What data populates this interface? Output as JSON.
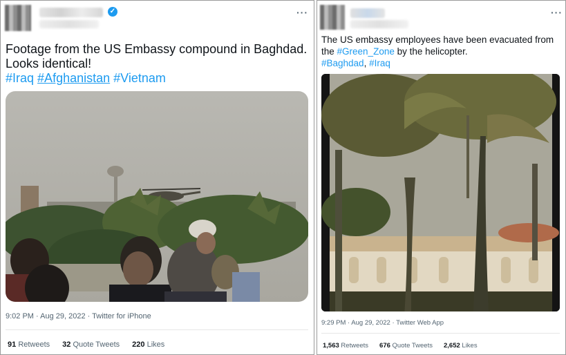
{
  "tweet1": {
    "text_line1": "Footage from the US Embassy compound in Baghdad.",
    "text_line2": "Looks identical!",
    "hashtags": [
      "#Iraq",
      "#Afghanistan",
      "#Vietnam"
    ],
    "timestamp": "9:02 PM · Aug 29, 2022 · Twitter for iPhone",
    "stats": {
      "retweets_count": "91",
      "retweets_label": "Retweets",
      "quotes_count": "32",
      "quotes_label": "Quote Tweets",
      "likes_count": "220",
      "likes_label": "Likes"
    },
    "more_glyph": "···"
  },
  "tweet2": {
    "text_line1": "The US embassy employees have been evacuated from",
    "text_line2_prefix": "the ",
    "text_line2_tag": "#Green_Zone",
    "text_line2_suffix": " by the helicopter.",
    "hashtag1": "#Baghdad",
    "separator": ", ",
    "hashtag2": "#Iraq",
    "timestamp": "9:29 PM · Aug 29, 2022 · Twitter Web App",
    "stats": {
      "retweets_count": "1,563",
      "retweets_label": "Retweets",
      "quotes_count": "676",
      "quotes_label": "Quote Tweets",
      "likes_count": "2,652",
      "likes_label": "Likes"
    },
    "more_glyph": "···"
  },
  "colors": {
    "link": "#1d9bf0",
    "text": "#0f1419",
    "muted": "#536471",
    "verified": "#1d9bf0"
  }
}
